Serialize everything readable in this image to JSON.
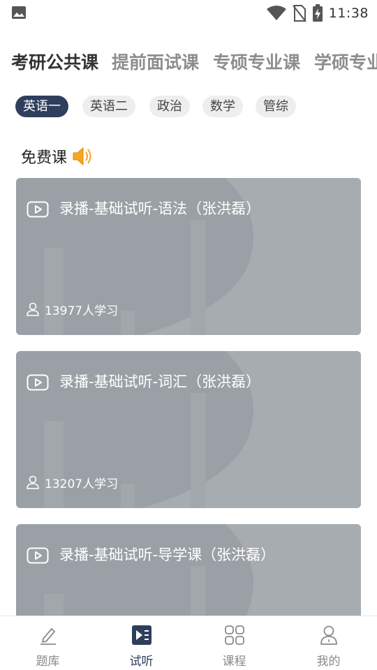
{
  "status_bar": {
    "time": "11:38",
    "icons": [
      "image-icon",
      "wifi-icon",
      "no-sim-icon",
      "battery-charging-icon"
    ]
  },
  "category_tabs": [
    {
      "label": "考研公共课",
      "active": true
    },
    {
      "label": "提前面试课",
      "active": false
    },
    {
      "label": "专硕专业课",
      "active": false
    },
    {
      "label": "学硕专业",
      "active": false
    }
  ],
  "subject_chips": [
    {
      "label": "英语一",
      "active": true
    },
    {
      "label": "英语二",
      "active": false
    },
    {
      "label": "政治",
      "active": false
    },
    {
      "label": "数学",
      "active": false
    },
    {
      "label": "管综",
      "active": false
    }
  ],
  "section": {
    "title": "免费课",
    "icon": "speaker-icon"
  },
  "courses": [
    {
      "title": "录播-基础试听-语法（张洪磊）",
      "learners": "13977人学习"
    },
    {
      "title": "录播-基础试听-词汇（张洪磊）",
      "learners": "13207人学习"
    },
    {
      "title": "录播-基础试听-导学课（张洪磊）",
      "learners": ""
    }
  ],
  "bottom_nav": [
    {
      "label": "题库",
      "icon": "edit-icon",
      "active": false
    },
    {
      "label": "试听",
      "icon": "video-list-icon",
      "active": true
    },
    {
      "label": "课程",
      "icon": "grid-icon",
      "active": false
    },
    {
      "label": "我的",
      "icon": "profile-icon",
      "active": false
    }
  ],
  "colors": {
    "accent": "#2f3e5c",
    "card": "#9aa0a5",
    "speaker": "#f5a623"
  }
}
